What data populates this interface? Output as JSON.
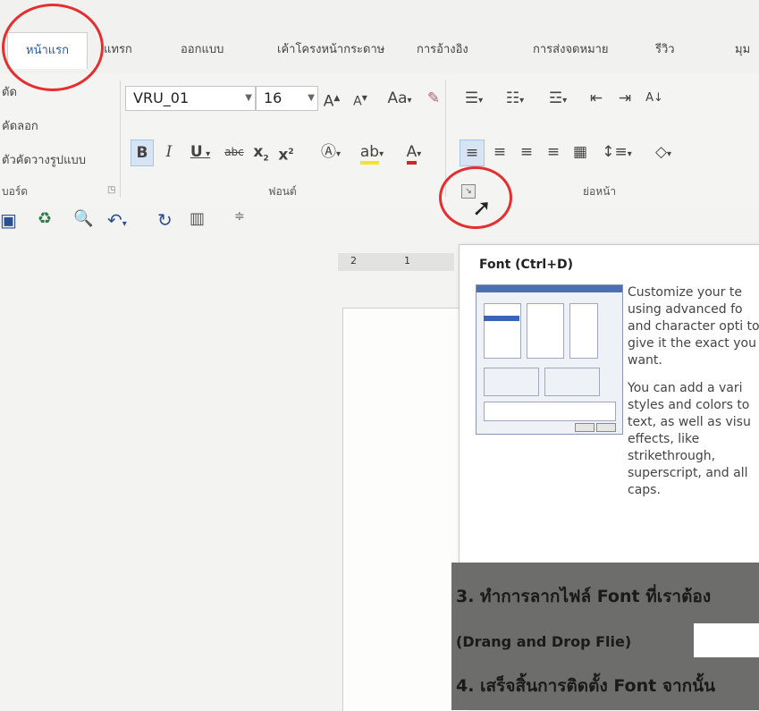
{
  "tabs": [
    {
      "label": "หน้าแรก"
    },
    {
      "label": "แทรก"
    },
    {
      "label": "ออกแบบ"
    },
    {
      "label": "เค้าโครงหน้ากระดาษ"
    },
    {
      "label": "การอ้างอิง"
    },
    {
      "label": "การส่งจดหมาย"
    },
    {
      "label": "รีวิว"
    },
    {
      "label": "มุม"
    }
  ],
  "clipboard": {
    "cut": "ตัด",
    "copy": "คัดลอก",
    "format_painter": "ตัวคัดวางรูปแบบ",
    "group_label": "บอร์ด"
  },
  "font": {
    "name": "VRU_01",
    "size": "16",
    "group_label": "ฟอนต์",
    "case_label": "Aa"
  },
  "paragraph": {
    "group_label": "ย่อหน้า"
  },
  "ruler": {
    "mark1": "2",
    "mark2": "1"
  },
  "tooltip": {
    "title": "Font (Ctrl+D)",
    "para1": "Customize your te using advanced fo and character opti to give it the exact you want.",
    "para2": "You can add a vari styles and colors to text, as well as visu effects, like strikethrough, superscript, and all caps."
  },
  "document": {
    "line1": "3. ทำการลากไฟล์ Font ที่เราต้อง",
    "line2": "(Drang and Drop Flie)",
    "line3": "4. เสร็จสิ้นการติดตั้ง Font จากนั้น"
  },
  "colors": {
    "highlight_circle": "#e52f2f",
    "active_tab_text": "#2a5aa3"
  }
}
